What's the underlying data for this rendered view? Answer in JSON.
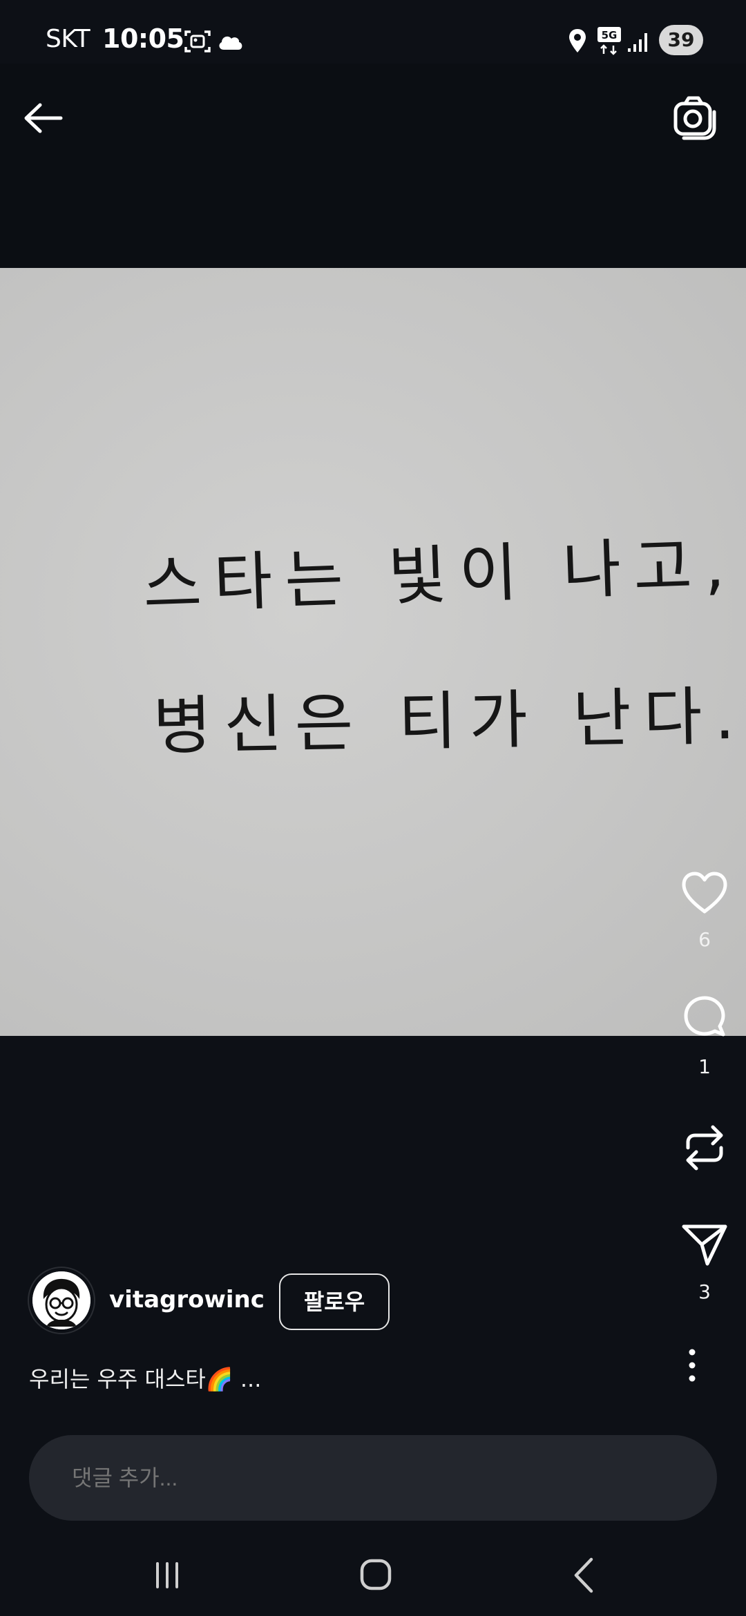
{
  "status_bar": {
    "carrier": "SKT",
    "time": "10:05",
    "battery": "39",
    "network": "5G",
    "icons": [
      "screenshot-icon",
      "cloud-icon",
      "location-icon",
      "5g-icon",
      "signal-icon",
      "battery-icon"
    ]
  },
  "header": {
    "back_icon": "back-arrow-icon",
    "camera_icon": "camera-icon"
  },
  "post_image": {
    "handwritten_line_1": "스타는 빛이 나고,",
    "handwritten_line_2": "병신은 티가 난다."
  },
  "actions": {
    "like_count": "6",
    "comment_count": "1",
    "share_count": "3",
    "icons": [
      "heart-icon",
      "comment-icon",
      "repost-icon",
      "send-icon",
      "more-icon"
    ]
  },
  "author": {
    "username": "vitagrowinc",
    "follow_label": "팔로우"
  },
  "caption": {
    "text": "우리는 우주 대스타🌈 ..."
  },
  "comment": {
    "placeholder": "댓글 추가..."
  },
  "nav_bar": {
    "icons": [
      "recent-apps-icon",
      "home-icon",
      "back-icon"
    ]
  },
  "colors": {
    "background": "#0d1016",
    "input_bg": "#23262d",
    "paper": "#c8c8c7",
    "text": "#ffffff"
  }
}
